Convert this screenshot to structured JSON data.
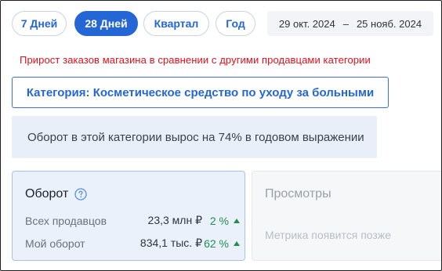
{
  "period_tabs": [
    {
      "label": "7 Дней",
      "active": false
    },
    {
      "label": "28 Дней",
      "active": true
    },
    {
      "label": "Квартал",
      "active": false
    },
    {
      "label": "Год",
      "active": false
    }
  ],
  "date_range": {
    "start": "29 окт. 2024",
    "separator": "–",
    "end": "25 нояб. 2024"
  },
  "alert_text": "Прирост заказов магазина в сравнении с другими продавцами категории",
  "category_button": "Категория: Косметическое средство по уходу за больными",
  "growth_note": "Оборот в этой категории вырос на 74% в годовом выражении",
  "turnover_card": {
    "title": "Оборот",
    "icon": "question-circle-icon",
    "rows": [
      {
        "label": "Всех продавцов",
        "value": "23,3 млн ₽",
        "change": "2 %",
        "trend": "up"
      },
      {
        "label": "Мой оборот",
        "value": "834,1 тыс. ₽",
        "change": "62 %",
        "trend": "up"
      }
    ]
  },
  "views_card": {
    "title": "Просмотры",
    "note": "Метрика появится позже"
  },
  "colors": {
    "accent": "#2466d6",
    "alert": "#e0101c",
    "positive": "#1f8f4b"
  }
}
